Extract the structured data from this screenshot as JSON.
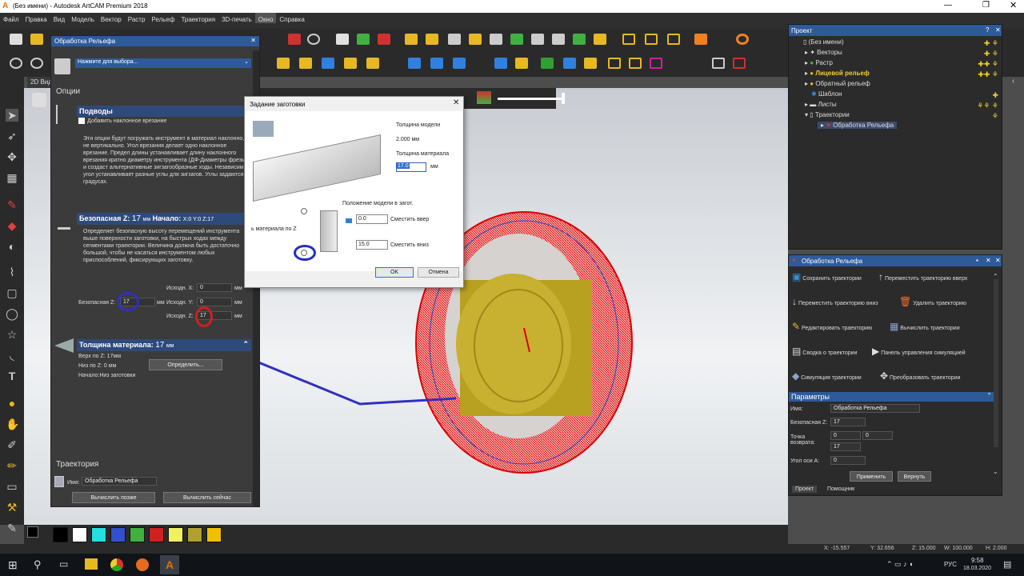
{
  "window": {
    "title": "(Без имени) - Autodesk ArtCAM Premium 2018"
  },
  "menu": [
    "Файл",
    "Правка",
    "Вид",
    "Модель",
    "Вектор",
    "Растр",
    "Рельеф",
    "Траектория",
    "3D-печать",
    "Окно",
    "Справка"
  ],
  "view_tab": "2D Вид",
  "relief_panel": {
    "title": "Обработка Рельефа",
    "tool_prompt": "Нажмите для выбора...",
    "options_label": "Опции",
    "ramps": {
      "title": "Подводы",
      "checkbox": "Добавить наклонное врезание",
      "desc": "Эти опции будут погружать инструмент в материал наклонно, а не вертикально. Угол врезания делает одно наклонное врезание. Предел длины устанавливает длину наклонного врезания кратно диаметру инструмента (ДФ-Диаметры фрезы) и создаст альтернативные зигзагообразные ходы. Независимый угол устанавливает разные углы для зигзагов. Углы задаются в градусах."
    },
    "safe_z": {
      "title_label": "Безопасная Z:",
      "title_value": "17",
      "title_unit": "мм",
      "start_label": "Начало:",
      "start_value": "X:0 Y:0 Z:17",
      "desc": "Определяет безопасную высоту перемещений инструмента выше поверхности заготовки, на быстрых ходах между сегментами траектории. Величина должна быть достаточно большой, чтобы не касаться инструментом любых приспособлений, фиксирующих заготовку.",
      "safe_label": "Безопасная Z:",
      "safe_value": "17",
      "home_x_label": "Исходн. X:",
      "home_x": "0",
      "home_y_label": "Исходн. Y:",
      "home_y": "0",
      "home_z_label": "Исходн. Z:",
      "home_z": "17",
      "unit": "мм"
    },
    "material": {
      "title_label": "Толщина материала:",
      "title_value": "17",
      "title_unit": "мм",
      "top": "Верх по Z: 17мм",
      "bottom": "Низ по Z:  0  мм",
      "origin": "Начало:Низ заготовки",
      "define_button": "Определить..."
    },
    "toolpath": {
      "title": "Траектория",
      "name_label": "Имя:",
      "name": "Обработка Рельефа",
      "later": "Вычислить позже",
      "now": "Вычислить сейчас"
    }
  },
  "dialog": {
    "title": "Задание заготовки",
    "model_thickness_label": "Толщина модели",
    "model_thickness": "2.000 мм",
    "material_thickness_label": "Толщина материала",
    "material_thickness": "17.0",
    "unit": "мм",
    "position_label": "Положение модели в загот.",
    "z_label": "ь материала по Z",
    "offset_up": "0.0",
    "offset_up_label": "Сместить вверх",
    "offset_down": "15.0",
    "offset_down_label": "Сместить вниз",
    "ok": "OK",
    "cancel": "Отмена"
  },
  "project": {
    "title": "Проект",
    "items": [
      "(Без имени)",
      "Векторы",
      "Растр",
      "Лицевой рельеф",
      "Обратный рельеф",
      "Шаблон",
      "Листы",
      "Траектории",
      "Обработка Рельефа"
    ]
  },
  "ops": {
    "title": "Обработка Рельефа",
    "actions": [
      "Сохранить траектории",
      "Переместить траекторию вверх",
      "Переместить траекторию вниз",
      "Удалить траекторию",
      "Редактировать траекторию",
      "Вычислить траектории",
      "Сводка о траектории",
      "Панель управления симуляцией",
      "Симуляция траектории",
      "Преобразовать траектории"
    ],
    "params_title": "Параметры",
    "name_label": "Имя:",
    "name": "Обработка Рельефа",
    "safe_label": "Безопасная Z:",
    "safe": "17",
    "home_label": "Точка возврата:",
    "home_x": "0",
    "home_y": "0",
    "home_z": "17",
    "angle_label": "Угол оси А:",
    "angle": "0",
    "apply": "Применить",
    "revert": "Вернуть",
    "tab_project": "Проект",
    "tab_helper": "Помощник"
  },
  "palette": [
    "#000000",
    "#ffffff",
    "#22e0e0",
    "#3050d0",
    "#40b040",
    "#d02020",
    "#f0f060",
    "#b0a030",
    "#f0c000"
  ],
  "status": {
    "x": "X: -15.557",
    "y": "Y: 32.656",
    "z": "Z: 15.000",
    "w": "W: 100.000",
    "h": "H: 2.000"
  },
  "taskbar": {
    "lang": "РУС",
    "time": "9:58",
    "date": "18.03.2020"
  }
}
